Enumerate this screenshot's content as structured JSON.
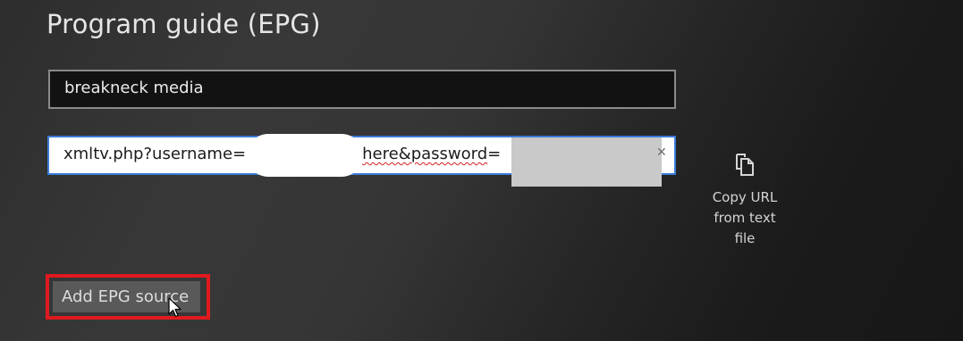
{
  "page": {
    "title": "Program guide (EPG)"
  },
  "epg_name": {
    "value": "breakneck media"
  },
  "epg_url": {
    "prefix": "xmltv.php?username=",
    "spell_segment": "here&password",
    "suffix": "="
  },
  "copy_action": {
    "label": "Copy URL\nfrom text\nfile",
    "icon": "copy-icon"
  },
  "add_button": {
    "label": "Add EPG source"
  },
  "colors": {
    "highlight": "#e0191f",
    "url_focus_border": "#3b7bd6",
    "spellcheck": "#d81e1e"
  }
}
